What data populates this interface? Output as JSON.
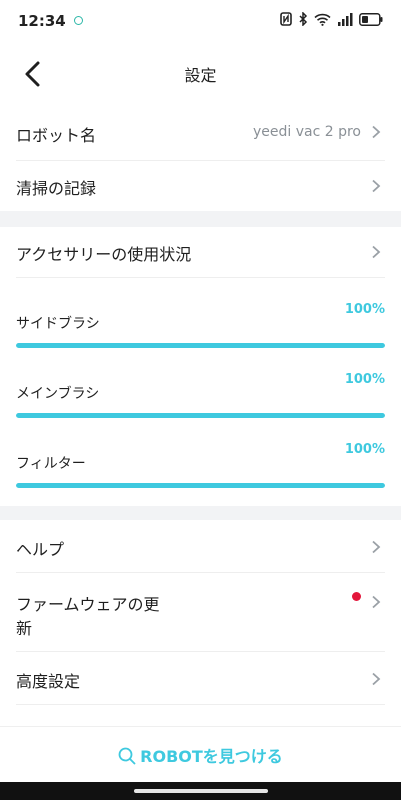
{
  "status_bar": {
    "time": "12:34"
  },
  "header": {
    "title": "設定"
  },
  "rows": {
    "robot_name": {
      "label": "ロボット名",
      "value": "yeedi vac 2 pro"
    },
    "cleaning_history": {
      "label": "清掃の記録"
    },
    "accessory_usage": {
      "label": "アクセサリーの使用状況"
    },
    "help": {
      "label": "ヘルプ"
    },
    "firmware_update": {
      "label_line1": "ファームウェアの更",
      "label_line2": "新",
      "has_update": true
    },
    "advanced_settings": {
      "label": "高度設定"
    }
  },
  "accessories": [
    {
      "label": "サイドブラシ",
      "percent_text": "100%",
      "percent": 100
    },
    {
      "label": "メインブラシ",
      "percent_text": "100%",
      "percent": 100
    },
    {
      "label": "フィルター",
      "percent_text": "100%",
      "percent": 100
    }
  ],
  "bottom": {
    "find_robot": "ROBOTを見つける"
  },
  "colors": {
    "accent": "#3ec9df",
    "badge": "#e3163b",
    "separator": "#f2f3f5"
  },
  "icons": [
    "back-arrow-icon",
    "chevron-right-icon",
    "search-icon",
    "nfc-icon",
    "bluetooth-icon",
    "wifi-icon",
    "signal-icon",
    "battery-icon"
  ]
}
